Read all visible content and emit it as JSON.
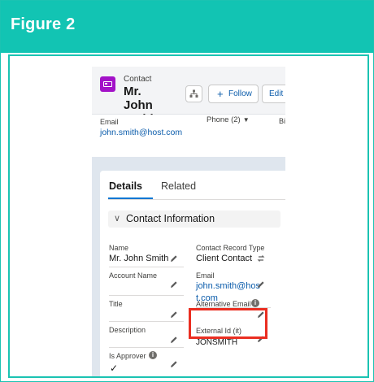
{
  "figure_title": "Figure 2",
  "record": {
    "object_type": "Contact",
    "name": "Mr. John Smith",
    "buttons": {
      "follow": "Follow",
      "follow_icon": "+",
      "edit": "Edit"
    }
  },
  "highlights": {
    "email_label": "Email",
    "email_value": "john.smith@host.com",
    "phone_label": "Phone (2)",
    "phone_caret": "▼",
    "truncated_label": "Bi"
  },
  "tabs": {
    "details": "Details",
    "related": "Related"
  },
  "section": {
    "chevron": "∨",
    "title": "Contact Information"
  },
  "fields": {
    "name_label": "Name",
    "name_value": "Mr. John Smith",
    "record_type_label": "Contact Record Type",
    "record_type_value": "Client Contact",
    "account_name_label": "Account Name",
    "email_label": "Email",
    "email_value_line1": "john.smith@hos",
    "email_value_line2": "t.com",
    "title_label": "Title",
    "alt_email_label": "Alternative Email",
    "description_label": "Description",
    "external_id_label": "External Id (it)",
    "external_id_value": "JONSMITH",
    "is_approver_label": "Is Approver",
    "is_approver_value": "✓",
    "info_glyph": "i"
  },
  "colors": {
    "header": "#12c4b3",
    "border": "#1bc3b2",
    "contact_icon": "#a312c8",
    "link": "#0b5cab",
    "highlight": "#ea2e21"
  },
  "icons": [
    "contact-card-icon",
    "hierarchy-icon",
    "plus-icon",
    "chevron-down-icon",
    "edit-pencil-icon",
    "change-record-type-icon",
    "info-icon",
    "checkmark-icon"
  ]
}
